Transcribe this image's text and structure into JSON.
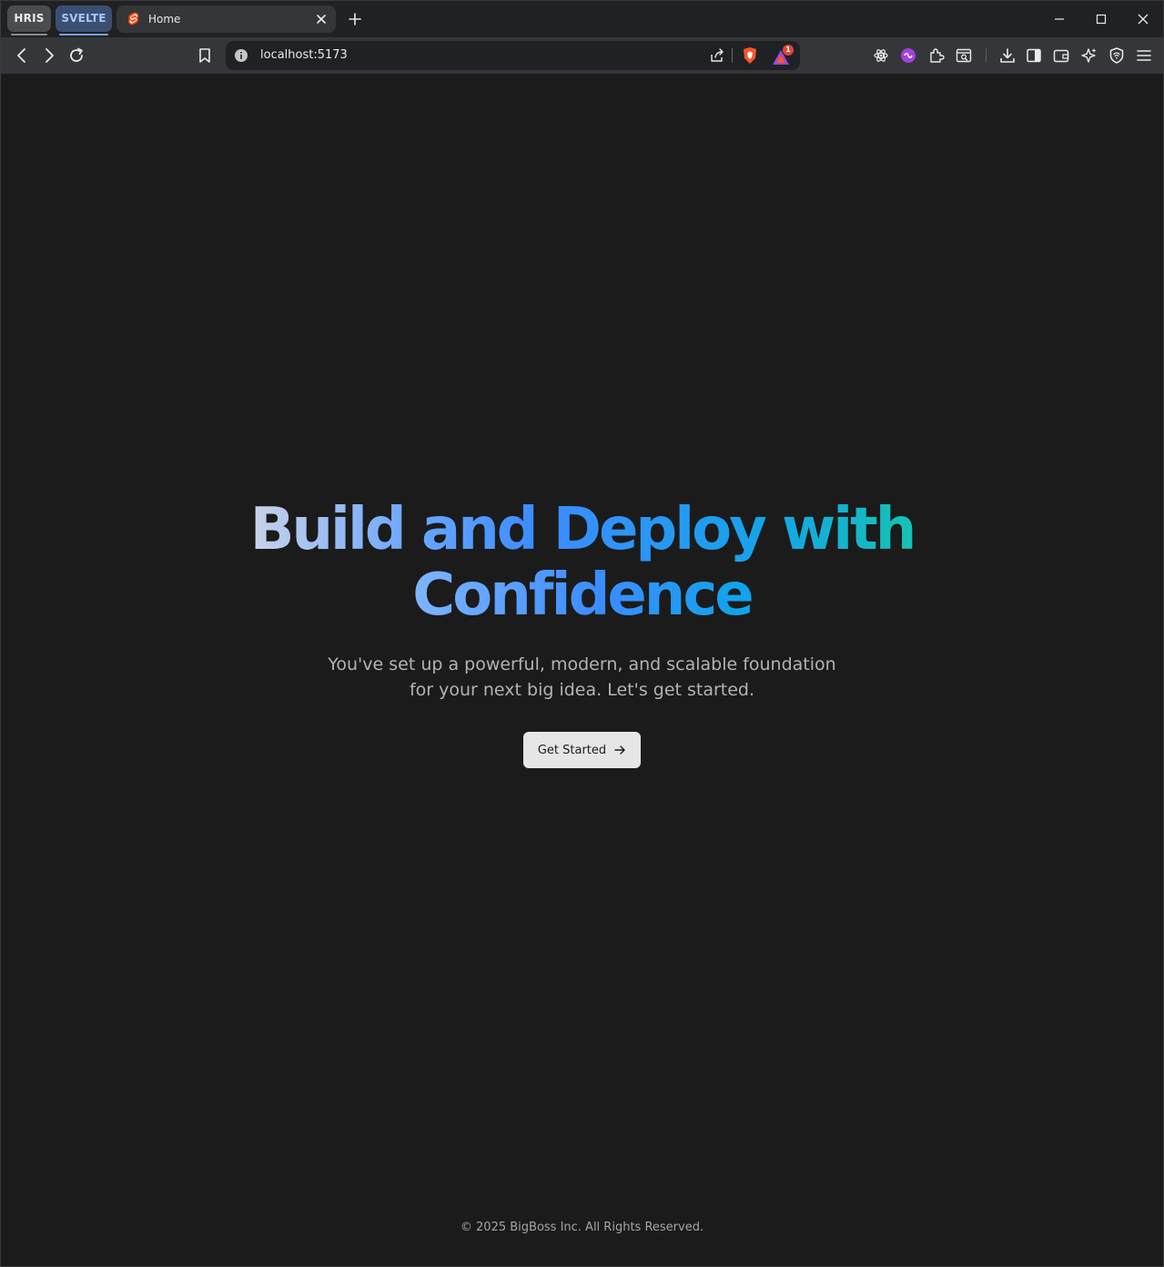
{
  "browser": {
    "tab_groups": [
      {
        "label": "HRIS"
      },
      {
        "label": "SVELTE"
      }
    ],
    "active_tab": {
      "title": "Home",
      "favicon": "svelte-logo-icon"
    },
    "url": "localhost:5173",
    "rewards_badge": "1"
  },
  "hero": {
    "headline_part1": "Build and",
    "headline_part2": "Deploy with",
    "headline_part3": "Confidence",
    "subtitle": "You've set up a powerful, modern, and scalable foundation for your next big idea. Let's get started.",
    "cta_label": "Get Started"
  },
  "footer": {
    "copyright": "© 2025 BigBoss Inc. All Rights Reserved."
  },
  "colors": {
    "page_bg": "#1b1b1b",
    "gradient_start": "#c9d3e8",
    "gradient_mid": "#3b8cff",
    "gradient_end": "#15c3b3",
    "button_bg": "#e6e6e6"
  }
}
